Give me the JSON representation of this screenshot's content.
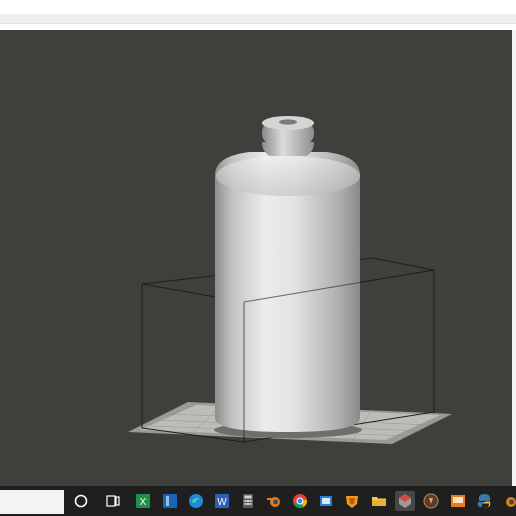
{
  "window": {
    "title": ""
  },
  "colors": {
    "viewport_bg": "#3f3f3c",
    "taskbar_bg": "#1f1f1f",
    "bottle": "#d8d8d8"
  },
  "taskbar": {
    "items": [
      {
        "name": "cortana-icon"
      },
      {
        "name": "task-view-icon"
      },
      {
        "name": "excel-icon"
      },
      {
        "name": "onenote-icon"
      },
      {
        "name": "edge-icon"
      },
      {
        "name": "word-icon"
      },
      {
        "name": "calculator-icon"
      },
      {
        "name": "blender-icon"
      },
      {
        "name": "chrome-icon"
      },
      {
        "name": "window-app-icon"
      },
      {
        "name": "shield-app-icon"
      },
      {
        "name": "file-explorer-icon"
      },
      {
        "name": "3d-slicer-icon"
      },
      {
        "name": "circle-app-icon"
      },
      {
        "name": "orange-app-icon"
      },
      {
        "name": "python-icon"
      },
      {
        "name": "blender-icon-2"
      }
    ]
  }
}
